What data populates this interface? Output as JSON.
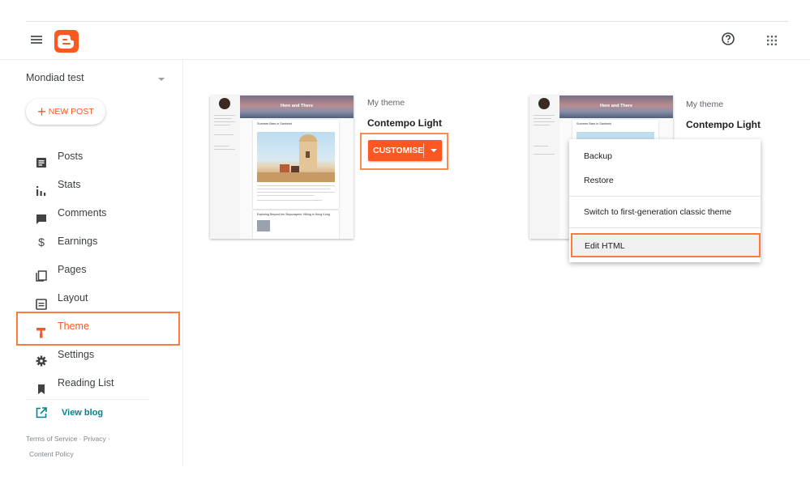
{
  "header": {
    "menu_icon": "hamburger-icon",
    "logo_icon": "blogger-logo-icon",
    "help_icon": "help-circle-icon",
    "apps_icon": "apps-grid-icon",
    "brand_color": "#ff5722"
  },
  "sidebar": {
    "blog_name": "Mondiad test",
    "new_post_label": "NEW POST",
    "items": [
      {
        "label": "Posts",
        "icon": "posts-icon"
      },
      {
        "label": "Stats",
        "icon": "stats-icon"
      },
      {
        "label": "Comments",
        "icon": "comments-icon"
      },
      {
        "label": "Earnings",
        "icon": "dollar-icon"
      },
      {
        "label": "Pages",
        "icon": "pages-icon"
      },
      {
        "label": "Layout",
        "icon": "layout-icon"
      },
      {
        "label": "Theme",
        "icon": "paint-roller-icon",
        "active": true
      },
      {
        "label": "Settings",
        "icon": "gear-icon"
      },
      {
        "label": "Reading List",
        "icon": "bookmark-icon"
      }
    ],
    "view_blog_label": "View blog",
    "footer": {
      "terms": "Terms of Service",
      "dot1": "·",
      "privacy": "Privacy",
      "dot2": "·",
      "content_policy": "Content Policy"
    }
  },
  "theme_left": {
    "label": "My theme",
    "name": "Contempo Light",
    "customise_label": "CUSTOMISE",
    "preview_header": "Here and There",
    "preview_post1": "Summer Bars in Santorini",
    "preview_post2": "Exploring Beyond the Skyscrapers: Hiking in Hong Kong"
  },
  "theme_right": {
    "label": "My theme",
    "name": "Contempo Light",
    "preview_header": "Here and There",
    "preview_post1": "Summer Bars in Santorini"
  },
  "dropdown_menu": {
    "items": [
      "Backup",
      "Restore",
      "Switch to first-generation classic theme",
      "Edit HTML"
    ]
  }
}
